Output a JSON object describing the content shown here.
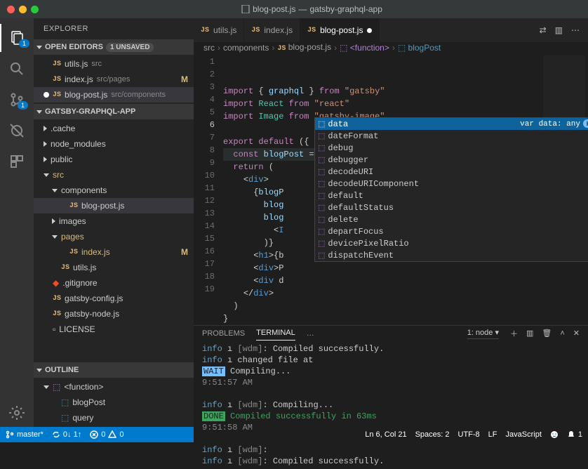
{
  "titlebar": {
    "filename": "blog-post.js",
    "project": "gatsby-graphql-app"
  },
  "sidebar": {
    "title": "EXPLORER",
    "open_editors": {
      "label": "OPEN EDITORS",
      "badge": "1 UNSAVED"
    },
    "editors": [
      {
        "name": "utils.js",
        "sub": "src",
        "mod": false
      },
      {
        "name": "index.js",
        "sub": "src/pages",
        "mod": true
      },
      {
        "name": "blog-post.js",
        "sub": "src/components",
        "mod": false,
        "selected": true,
        "dirty": true
      }
    ],
    "project": {
      "label": "GATSBY-GRAPHQL-APP"
    },
    "tree": [
      {
        "type": "folder",
        "name": ".cache",
        "depth": 0,
        "open": false
      },
      {
        "type": "folder",
        "name": "node_modules",
        "depth": 0,
        "open": false
      },
      {
        "type": "folder",
        "name": "public",
        "depth": 0,
        "open": false
      },
      {
        "type": "folder",
        "name": "src",
        "depth": 0,
        "open": true,
        "mod": true
      },
      {
        "type": "folder",
        "name": "components",
        "depth": 1,
        "open": true
      },
      {
        "type": "file",
        "name": "blog-post.js",
        "depth": 2,
        "icon": "js",
        "selected": true
      },
      {
        "type": "folder",
        "name": "images",
        "depth": 1,
        "open": false
      },
      {
        "type": "folder",
        "name": "pages",
        "depth": 1,
        "open": true,
        "mod": true
      },
      {
        "type": "file",
        "name": "index.js",
        "depth": 2,
        "icon": "js",
        "mod": true
      },
      {
        "type": "file",
        "name": "utils.js",
        "depth": 1,
        "icon": "js"
      },
      {
        "type": "file",
        "name": ".gitignore",
        "depth": 0,
        "icon": "git"
      },
      {
        "type": "file",
        "name": "gatsby-config.js",
        "depth": 0,
        "icon": "js"
      },
      {
        "type": "file",
        "name": "gatsby-node.js",
        "depth": 0,
        "icon": "js"
      },
      {
        "type": "file",
        "name": "LICENSE",
        "depth": 0,
        "icon": "txt"
      }
    ],
    "outline": {
      "label": "OUTLINE",
      "items": [
        {
          "name": "<function>",
          "depth": 0,
          "open": true,
          "icon": "ol"
        },
        {
          "name": "blogPost",
          "depth": 1,
          "icon": "fn"
        },
        {
          "name": "query",
          "depth": 1,
          "icon": "fn"
        }
      ]
    }
  },
  "tabs": [
    {
      "name": "utils.js"
    },
    {
      "name": "index.js"
    },
    {
      "name": "blog-post.js",
      "active": true,
      "dirty": true
    }
  ],
  "breadcrumbs": [
    {
      "text": "src"
    },
    {
      "text": "components"
    },
    {
      "text": "blog-post.js",
      "js": true
    },
    {
      "text": "<function>",
      "ol": true
    },
    {
      "text": "blogPost",
      "fn": true
    }
  ],
  "code": {
    "lines": [
      "import { graphql } from \"gatsby\"",
      "import React from \"react\"",
      "import Image from \"gatsby-image\"",
      "",
      "export default ({ data }) => {",
      "  const blogPost = d",
      "  return (",
      "    <div>",
      "      {blogP",
      "        blog",
      "        blog",
      "          <I",
      "        )}",
      "      <h1>{b",
      "      <div>P",
      "      <div d",
      "    </div>",
      "  )",
      "}"
    ],
    "activeLine": 6,
    "cursorCol": 21
  },
  "suggest": {
    "items": [
      {
        "label": "data",
        "selected": true,
        "detail": "var data: any"
      },
      {
        "label": "dateFormat"
      },
      {
        "label": "debug"
      },
      {
        "label": "debugger"
      },
      {
        "label": "decodeURI"
      },
      {
        "label": "decodeURIComponent"
      },
      {
        "label": "default"
      },
      {
        "label": "defaultStatus"
      },
      {
        "label": "delete"
      },
      {
        "label": "departFocus"
      },
      {
        "label": "devicePixelRatio"
      },
      {
        "label": "dispatchEvent"
      }
    ]
  },
  "panel": {
    "tabs": [
      {
        "name": "PROBLEMS"
      },
      {
        "name": "TERMINAL",
        "active": true
      },
      {
        "name": "…"
      }
    ],
    "selector": "1: node",
    "lines": [
      {
        "p": "info",
        "w": " ",
        "d": "[wdm]",
        "t": ": Compiled successfully."
      },
      {
        "p": "info",
        "t": " changed file at"
      },
      {
        "wait": "WAIT",
        "t": "  Compiling..."
      },
      {
        "time": "9:51:57 AM"
      },
      {
        "t": ""
      },
      {
        "p": "info",
        "w": " ",
        "d": "[wdm]",
        "t": ": Compiling..."
      },
      {
        "done": "DONE",
        "ok": "  Compiled successfully in 63ms"
      },
      {
        "time": "9:51:58 AM"
      },
      {
        "t": ""
      },
      {
        "p": "info",
        "w": " ",
        "d": "[wdm]",
        "t": ":"
      },
      {
        "p": "info",
        "w": " ",
        "d": "[wdm]",
        "t": ": Compiled successfully."
      }
    ]
  },
  "status": {
    "branch": "master*",
    "sync": "0↓ 1↑",
    "errors": "0",
    "warnings": "0",
    "cursor": "Ln 6, Col 21",
    "spaces": "Spaces: 2",
    "encoding": "UTF-8",
    "eol": "LF",
    "lang": "JavaScript",
    "notif": "1"
  },
  "activity_badges": {
    "explorer": "1",
    "scm": "1"
  }
}
